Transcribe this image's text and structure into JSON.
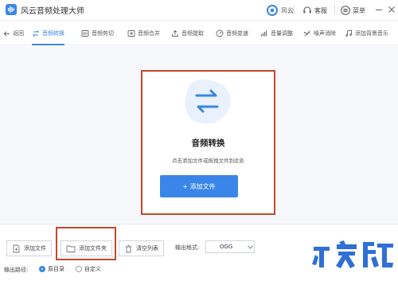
{
  "titlebar": {
    "app_title": "风云音频处理大师",
    "user_label": "风云",
    "support_label": "客服",
    "menu_label": "菜单"
  },
  "nav": {
    "back_label": "返回",
    "items": [
      {
        "label": "音频转换",
        "icon": "convert-icon"
      },
      {
        "label": "音频剪切",
        "icon": "cut-icon"
      },
      {
        "label": "音频合并",
        "icon": "merge-icon"
      },
      {
        "label": "音频提取",
        "icon": "extract-icon"
      },
      {
        "label": "音频变速",
        "icon": "speed-icon"
      },
      {
        "label": "音量调整",
        "icon": "volume-icon"
      },
      {
        "label": "噪声消除",
        "icon": "denoise-icon"
      },
      {
        "label": "添加背景音乐",
        "icon": "music-icon"
      }
    ]
  },
  "drop_zone": {
    "title": "音频转换",
    "hint": "点击添加文件或拖拽文件到此处",
    "add_button": "+ 添加文件"
  },
  "bottom": {
    "add_file": "添加文件",
    "add_folder": "添加文件夹",
    "clear_list": "清空列表",
    "format_label": "输出格式:",
    "format_value": "OGG",
    "path_label": "输出路径:",
    "path_options": [
      {
        "label": "原目录",
        "checked": true
      },
      {
        "label": "自定义",
        "checked": false
      }
    ]
  },
  "colors": {
    "accent": "#3a86e8",
    "highlight_frame": "#c8452d"
  }
}
